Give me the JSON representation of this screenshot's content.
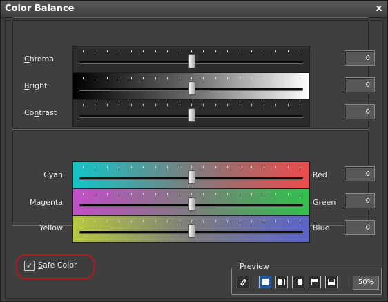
{
  "window": {
    "title": "Color Balance",
    "close_glyph": "x"
  },
  "sliders_top": [
    {
      "label": "Chroma",
      "value": "0",
      "level": 0.5,
      "style": "dark"
    },
    {
      "label": "Bright",
      "value": "0",
      "level": 0.5,
      "style": "gray-gradient"
    },
    {
      "label": "Contrast",
      "value": "0",
      "level": 0.5,
      "style": "dark"
    }
  ],
  "sliders_color": [
    {
      "left_label": "Cyan",
      "right_label": "Red",
      "value": "0",
      "level": 0.5,
      "gradient": [
        "#11c6c8",
        "#ee4a4a"
      ]
    },
    {
      "left_label": "Magenta",
      "right_label": "Green",
      "value": "0",
      "level": 0.5,
      "gradient": [
        "#c24ec9",
        "#2fc24a"
      ]
    },
    {
      "left_label": "Yellow",
      "right_label": "Blue",
      "value": "0",
      "level": 0.5,
      "gradient": [
        "#b7c83f",
        "#5a63c9"
      ]
    }
  ],
  "safe_color": {
    "label": "Safe Color",
    "checked": true
  },
  "preview": {
    "label": "Preview",
    "buttons": [
      "eraser-icon",
      "full-view-icon",
      "split-left-icon",
      "split-right-icon",
      "split-top-icon",
      "split-bottom-icon"
    ],
    "active_index": 1,
    "zoom": "50%"
  },
  "colors": {
    "highlight": "#c0131b",
    "active_button": "#1b5ea8"
  }
}
